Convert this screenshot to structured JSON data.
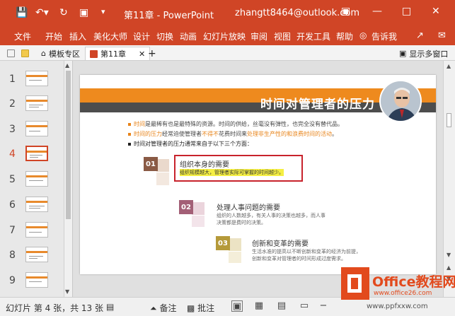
{
  "titlebar": {
    "title": "第11章 - PowerPoint",
    "account": "zhangtt8464@outlook.com"
  },
  "ribbon": {
    "tabs": [
      "文件",
      "开始",
      "插入",
      "美化大师",
      "设计",
      "切换",
      "动画",
      "幻灯片放映",
      "审阅",
      "视图",
      "开发工具",
      "帮助",
      "告诉我"
    ]
  },
  "doctabs": {
    "tab1": "模板专区",
    "tab2": "第11章",
    "show_multi": "显示多窗口"
  },
  "thumbnails": {
    "numbers": [
      "1",
      "2",
      "3",
      "4",
      "5",
      "6",
      "7",
      "8",
      "9"
    ],
    "selected": 4
  },
  "slide": {
    "title": "时间对管理者的压力",
    "bullets": [
      {
        "parts": [
          {
            "t": "时间",
            "c": "orange"
          },
          {
            "t": "是最稀有也是最特殊的资源。时间的供给，丝毫没有弹性，也完全没有替代品。",
            "c": "gray"
          }
        ]
      },
      {
        "parts": [
          {
            "t": "时间的压力",
            "c": "orange"
          },
          {
            "t": "经常迫使管理者",
            "c": "gray"
          },
          {
            "t": "不得不",
            "c": "orange"
          },
          {
            "t": "花费时间来",
            "c": "gray"
          },
          {
            "t": "处理非生产性的和浪费时间的活动",
            "c": "orange"
          },
          {
            "t": "。",
            "c": "gray"
          }
        ]
      },
      {
        "parts": [
          {
            "t": "时间对管理者的压力通常来自于以下三个方面：",
            "c": "dark"
          }
        ]
      }
    ],
    "items": [
      {
        "num": "01",
        "title": "组织本身的需要",
        "desc": [
          "组织规模越大，管理者实际可掌握的时间越少。"
        ]
      },
      {
        "num": "02",
        "title": "处理人事问题的需要",
        "desc": [
          "组织的人数越多，有关人事的决策也越多，而人事",
          "决策都是费时的决策。"
        ]
      },
      {
        "num": "03",
        "title": "创新和变革的需要",
        "desc": [
          "生活水准的提高以不断创新和变革的经济为前提，",
          "创新和变革对管理者的时间形成过度需求。"
        ]
      }
    ]
  },
  "status": {
    "slide_info": "幻灯片 第 4 张，共 13 张",
    "notes": "备注",
    "comments": "批注"
  },
  "watermark": {
    "brand": "Office教程网",
    "url": "www.office26.com",
    "site": "www.ppfxxw.com"
  },
  "colors": {
    "accent": "#d04526",
    "slide_orange": "#ee8a1e"
  }
}
